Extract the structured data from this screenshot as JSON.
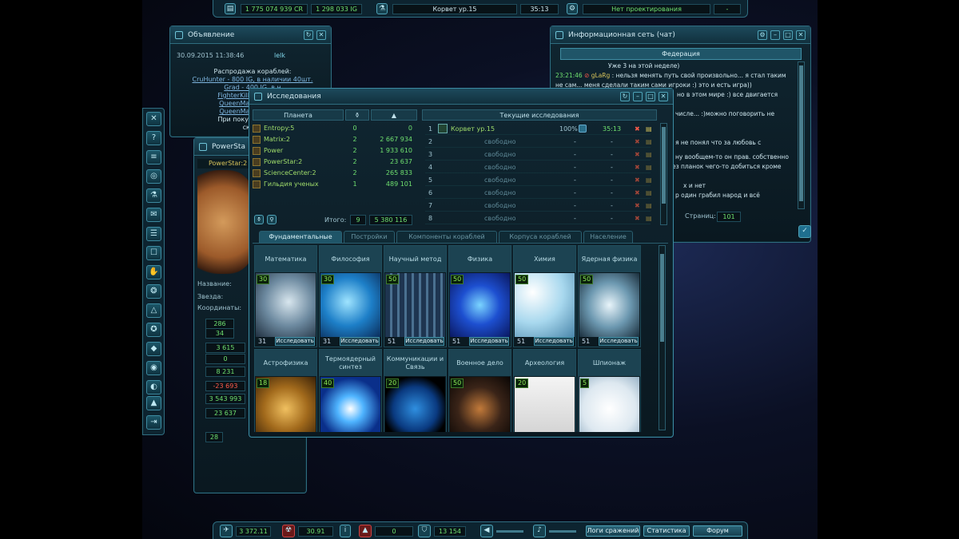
{
  "topbar": {
    "credits": "1 775 074 939 CR",
    "ig": "1 298 033 IG",
    "ship": "Корвет ур.15",
    "timer": "35:13",
    "project": "Нет проектирования",
    "dash": "-"
  },
  "announce": {
    "title": "Объявление",
    "date": "30.09.2015 11:38:46",
    "author": "lelk",
    "lines": [
      "Распродажа кораблей:",
      "CruHunter - 800 IG, в наличии 40шт.",
      "Grad - 400 IG, в н",
      "FighterKiller - 2500 IG",
      "QueenMary_K - 3500",
      "QueenMary_P - 4000",
      "При покупке всех ко",
      "скидк"
    ]
  },
  "chat": {
    "title": "Информационная сеть (чат)",
    "tab": "Федерация",
    "pages_label": "Страниц:",
    "pages": "101",
    "lines": [
      {
        "time": "",
        "user": "",
        "text": "Уже 3 на этой неделе)"
      },
      {
        "time": "23:21:46",
        "user": "gLaRg",
        "text": ": нельзя менять путь свой произвольно... я стал таким"
      },
      {
        "time": "",
        "user": "",
        "text": "не сам... меня сделали таким сами игроки :) это и есть игра))"
      },
      {
        "time": "",
        "user": "",
        "text": "но в этом мире :) все двигается"
      },
      {
        "time": "",
        "user": "",
        "text": "числе... :)можно поговорить не"
      },
      {
        "time": "",
        "user": "",
        "text": "я не понял что за любовь с"
      },
      {
        "time": "",
        "user": "",
        "text": "ну вообщем-то он прав. собственно"
      },
      {
        "time": "",
        "user": "",
        "text": "ез планок чего-то добиться кроме"
      },
      {
        "time": "",
        "user": "",
        "text": "х и нет"
      },
      {
        "time": "",
        "user": "",
        "text": "р один грабил народ и всё"
      }
    ]
  },
  "planet": {
    "title": "PowerSta",
    "name_tab": "PowerStar:2",
    "name_label": "Название:",
    "star_label": "Звезда:",
    "coords_label": "Координаты:",
    "stats": [
      "286",
      "34",
      "3 615",
      "0",
      "8 231",
      "-23 693",
      "3 543 993",
      "23 637",
      "28"
    ]
  },
  "research": {
    "title": "Исследования",
    "planet_header": "Планета",
    "current_header": "Текущие исследования",
    "planets": [
      {
        "name": "Entropy:5",
        "a": "0",
        "b": "0"
      },
      {
        "name": "Matrix:2",
        "a": "2",
        "b": "2 667 934"
      },
      {
        "name": "Power",
        "a": "2",
        "b": "1 933 610"
      },
      {
        "name": "PowerStar:2",
        "a": "2",
        "b": "23 637"
      },
      {
        "name": "ScienceCenter:2",
        "a": "2",
        "b": "265 833"
      },
      {
        "name": "Гильдия ученых",
        "a": "1",
        "b": "489 101"
      }
    ],
    "total_label": "Итого:",
    "total_a": "9",
    "total_b": "5 380 116",
    "queue": [
      {
        "n": "1",
        "name": "Корвет ур.15",
        "pct": "100%",
        "time": "35:13"
      },
      {
        "n": "2",
        "name": "свободно",
        "pct": "-",
        "time": "-"
      },
      {
        "n": "3",
        "name": "свободно",
        "pct": "-",
        "time": "-"
      },
      {
        "n": "4",
        "name": "свободно",
        "pct": "-",
        "time": "-"
      },
      {
        "n": "5",
        "name": "свободно",
        "pct": "-",
        "time": "-"
      },
      {
        "n": "6",
        "name": "свободно",
        "pct": "-",
        "time": "-"
      },
      {
        "n": "7",
        "name": "свободно",
        "pct": "-",
        "time": "-"
      },
      {
        "n": "8",
        "name": "свободно",
        "pct": "-",
        "time": "-"
      }
    ],
    "tabs": [
      "Фундаментальные",
      "Постройки",
      "Компоненты кораблей",
      "Корпуса кораблей",
      "Население"
    ],
    "button_label": "Исследовать",
    "cards": [
      {
        "title": "Математика",
        "level": "30",
        "count": "31"
      },
      {
        "title": "Философия",
        "level": "30",
        "count": "31"
      },
      {
        "title": "Научный метод",
        "level": "50",
        "count": "51"
      },
      {
        "title": "Физика",
        "level": "50",
        "count": "51"
      },
      {
        "title": "Химия",
        "level": "50",
        "count": "51"
      },
      {
        "title": "Ядерная физика",
        "level": "50",
        "count": "51"
      },
      {
        "title": "Астрофизика",
        "level": "18",
        "count": ""
      },
      {
        "title": "Термоядерный синтез",
        "level": "40",
        "count": ""
      },
      {
        "title": "Коммуникации и Связь",
        "level": "20",
        "count": ""
      },
      {
        "title": "Военное дело",
        "level": "50",
        "count": ""
      },
      {
        "title": "Археология",
        "level": "20",
        "count": ""
      },
      {
        "title": "Шпионаж",
        "level": "5",
        "count": ""
      }
    ]
  },
  "botbar": {
    "v1": "3 372.11",
    "v2": "30.91",
    "v3": "0",
    "v4": "13 154",
    "battle_logs": "Логи сражений",
    "stats": "Статистика",
    "forum": "Форум"
  }
}
